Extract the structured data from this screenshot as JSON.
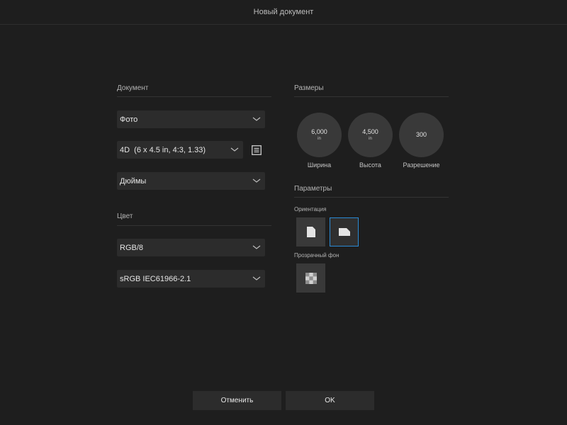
{
  "header": {
    "title": "Новый документ"
  },
  "document_section": {
    "title": "Документ",
    "type_dropdown": "Фото",
    "preset_dropdown": "4D  (6 x 4.5 in, 4:3, 1.33)",
    "units_dropdown": "Дюймы"
  },
  "color_section": {
    "title": "Цвет",
    "mode_dropdown": "RGB/8",
    "profile_dropdown": "sRGB IEC61966-2.1"
  },
  "size_section": {
    "title": "Размеры",
    "width": {
      "value": "6,000",
      "unit": "in",
      "label": "Ширина"
    },
    "height": {
      "value": "4,500",
      "unit": "in",
      "label": "Высота"
    },
    "resolution": {
      "value": "300",
      "label": "Разрешение"
    }
  },
  "params_section": {
    "title": "Параметры",
    "orientation_label": "Ориентация",
    "orientation_selected": "landscape",
    "transparent_label": "Прозрачный фон"
  },
  "footer": {
    "cancel_label": "Отменить",
    "ok_label": "OK"
  },
  "colors": {
    "background": "#1e1e1e",
    "control": "#2c2c2c",
    "accent": "#2a8ad4"
  },
  "icons": {
    "preset_details": "list-icon",
    "dropdown": "chevron-down-icon",
    "portrait": "portrait-page-icon",
    "landscape": "landscape-page-icon",
    "transparent": "checkerboard-icon"
  }
}
